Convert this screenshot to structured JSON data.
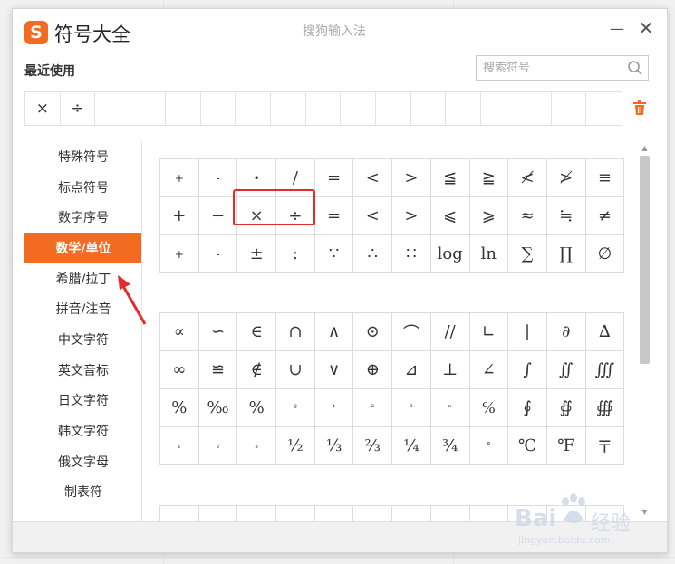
{
  "window": {
    "app_title": "符号大全",
    "logo_letter": "S",
    "ime_name": "搜狗输入法",
    "minimize_glyph": "—",
    "close_glyph": "✕"
  },
  "recent": {
    "label": "最近使用",
    "symbols": [
      "×",
      "÷",
      "",
      "",
      "",
      "",
      "",
      "",
      "",
      "",
      "",
      "",
      "",
      "",
      "",
      "",
      ""
    ]
  },
  "search": {
    "placeholder": "搜索符号",
    "value": ""
  },
  "sidebar": {
    "items": [
      {
        "label": "特殊符号",
        "active": false
      },
      {
        "label": "标点符号",
        "active": false
      },
      {
        "label": "数字序号",
        "active": false
      },
      {
        "label": "数学/单位",
        "active": true
      },
      {
        "label": "希腊/拉丁",
        "active": false
      },
      {
        "label": "拼音/注音",
        "active": false
      },
      {
        "label": "中文字符",
        "active": false
      },
      {
        "label": "英文音标",
        "active": false
      },
      {
        "label": "日文字符",
        "active": false
      },
      {
        "label": "韩文字符",
        "active": false
      },
      {
        "label": "俄文字母",
        "active": false
      },
      {
        "label": "制表符",
        "active": false
      }
    ]
  },
  "grid_sections": [
    {
      "rows": [
        [
          "+",
          "-",
          "•",
          "/",
          "=",
          "<",
          ">",
          "≦",
          "≧",
          "≮",
          "≯",
          "≡"
        ],
        [
          "+",
          "−",
          "×",
          "÷",
          "=",
          "<",
          ">",
          "⩽",
          "⩾",
          "≈",
          "≒",
          "≠"
        ],
        [
          "+",
          "-",
          "±",
          ":",
          "∵",
          "∴",
          "∷",
          "log",
          "ln",
          "∑",
          "∏",
          "∅"
        ]
      ]
    },
    {
      "rows": [
        [
          "∝",
          "∽",
          "∈",
          "∩",
          "∧",
          "⊙",
          "⌒",
          "//",
          "∟",
          "|",
          "∂",
          "∆"
        ],
        [
          "∞",
          "≌",
          "∉",
          "∪",
          "∨",
          "⊕",
          "⊿",
          "⊥",
          "∠",
          "∫",
          "∬",
          "∭"
        ],
        [
          "%",
          "‰",
          "%",
          "º",
          "¹",
          "²",
          "³",
          "ⁿ",
          "℅",
          "∮",
          "∯",
          "∰"
        ],
        [
          "₁",
          "₂",
          "₃",
          "½",
          "⅓",
          "⅔",
          "¼",
          "¾",
          "°",
          "℃",
          "℉",
          "〒"
        ]
      ]
    }
  ],
  "watermark": {
    "brand": "Bai",
    "brand_tail": "经验",
    "url": "jingyan.baidu.com"
  },
  "colors": {
    "accent": "#f26b21",
    "highlight": "#e32b2b"
  }
}
